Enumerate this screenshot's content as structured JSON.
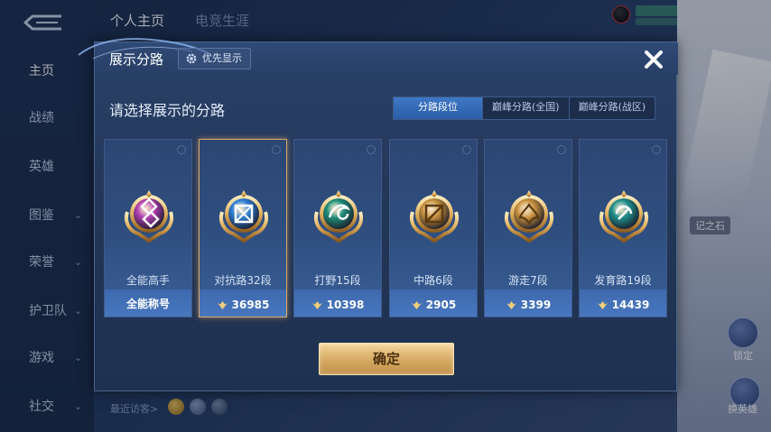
{
  "background": {
    "sidebar": [
      {
        "label": "主页",
        "has_chevron": false
      },
      {
        "label": "战绩",
        "has_chevron": false
      },
      {
        "label": "英雄",
        "has_chevron": false
      },
      {
        "label": "图鉴",
        "has_chevron": true
      },
      {
        "label": "荣誉",
        "has_chevron": true
      },
      {
        "label": "护卫队",
        "has_chevron": true
      },
      {
        "label": "游戏",
        "has_chevron": true
      },
      {
        "label": "社交",
        "has_chevron": true
      }
    ],
    "top_tabs": [
      "个人主页",
      "电竞生涯"
    ],
    "visitors_label": "最近访客>",
    "right_panel": {
      "stone_label": "记之石",
      "lock_label": "锁定",
      "switch_hero_label": "换英雄"
    }
  },
  "dialog": {
    "title": "展示分路",
    "priority_button": "优先显示",
    "subtitle": "请选择展示的分路",
    "tabs": [
      {
        "label": "分路段位",
        "active": true
      },
      {
        "label": "巅峰分路(全国)",
        "active": false
      },
      {
        "label": "巅峰分路(战区)",
        "active": false
      }
    ],
    "cards": [
      {
        "role": "all-round",
        "rank_label": "全能高手",
        "bottom": "全能称号",
        "has_score_icon": false,
        "selected": false,
        "emblem_color": "#b23fb2"
      },
      {
        "role": "clash-lane",
        "rank_label": "对抗路32段",
        "bottom": "36985",
        "has_score_icon": true,
        "selected": true,
        "emblem_color": "#2f7fd6"
      },
      {
        "role": "jungle",
        "rank_label": "打野15段",
        "bottom": "10398",
        "has_score_icon": true,
        "selected": false,
        "emblem_color": "#1f8f7a"
      },
      {
        "role": "mid-lane",
        "rank_label": "中路6段",
        "bottom": "2905",
        "has_score_icon": true,
        "selected": false,
        "emblem_color": "#c9923e"
      },
      {
        "role": "roam",
        "rank_label": "游走7段",
        "bottom": "3399",
        "has_score_icon": true,
        "selected": false,
        "emblem_color": "#c9923e"
      },
      {
        "role": "farm-lane",
        "rank_label": "发育路19段",
        "bottom": "14439",
        "has_score_icon": true,
        "selected": false,
        "emblem_color": "#1f8f8a"
      }
    ],
    "confirm_button": "确定"
  }
}
